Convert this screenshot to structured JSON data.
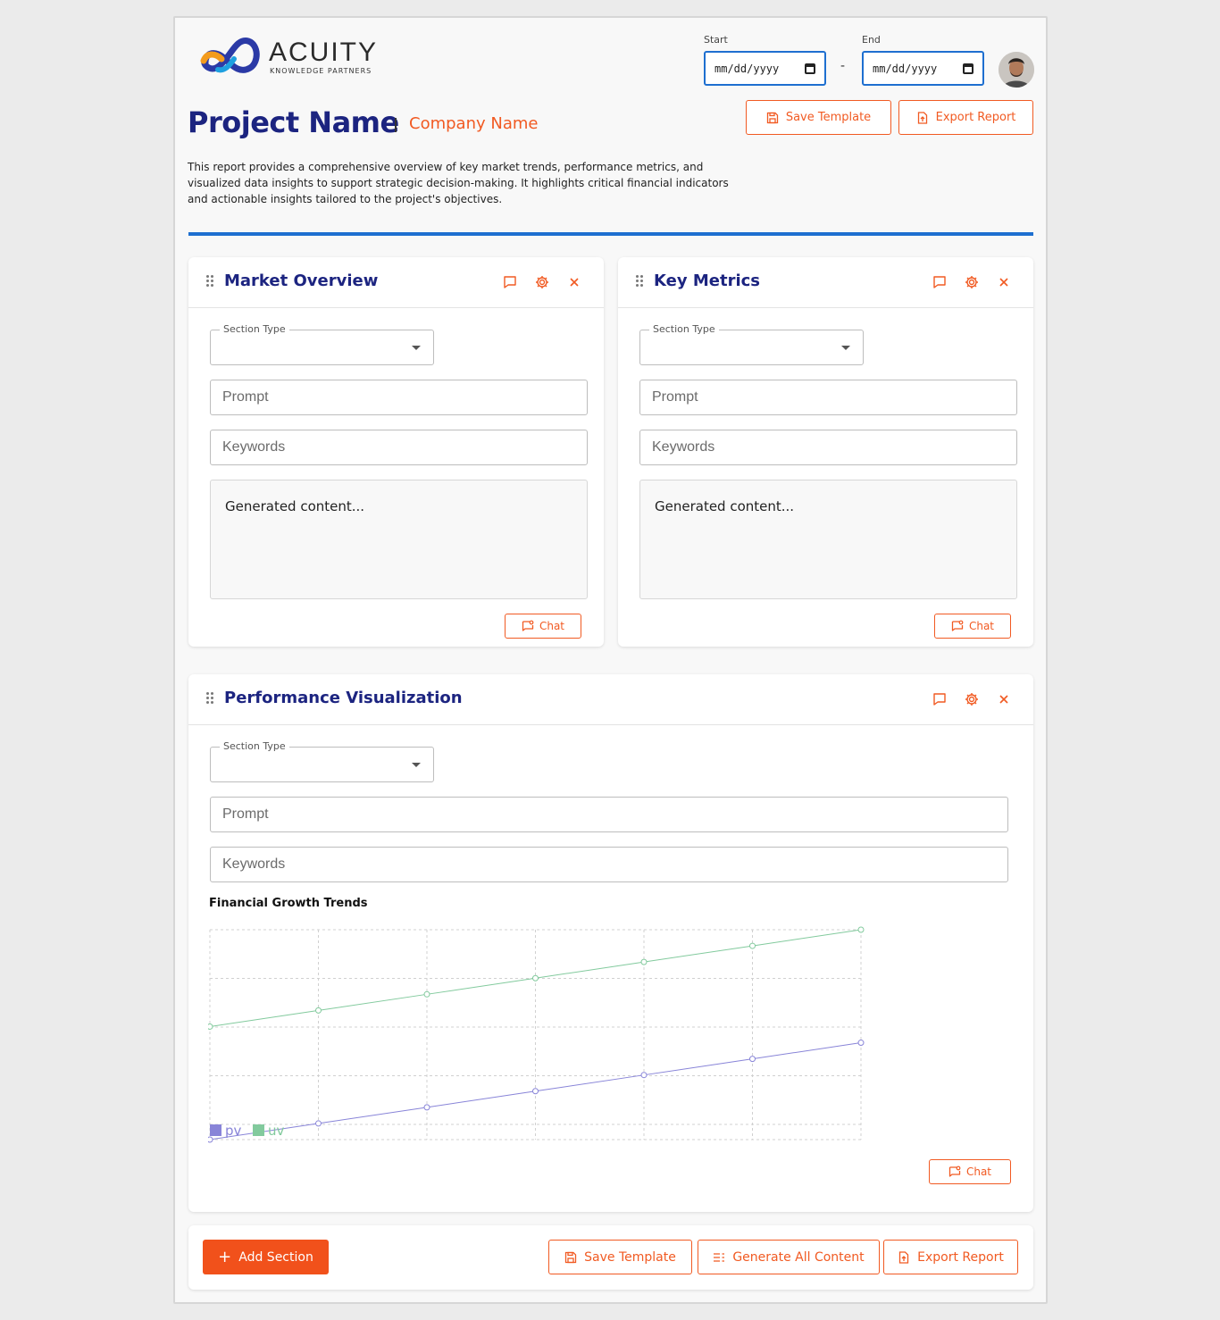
{
  "brand": {
    "name": "ACUITY",
    "tagline": "KNOWLEDGE PARTNERS"
  },
  "header": {
    "start_label": "Start",
    "end_label": "End",
    "date_placeholder": "mm/dd/yyyy",
    "separator": "-",
    "project_name": "Project Name",
    "company_name": "Company Name",
    "save_template": "Save Template",
    "export_report": "Export Report",
    "description": "This report provides a comprehensive overview of key market trends, performance metrics, and visualized data insights to support strategic decision-making. It highlights critical financial indicators and actionable insights tailored to the project's objectives."
  },
  "sections": [
    {
      "title": "Market Overview",
      "section_type_label": "Section Type",
      "prompt_placeholder": "Prompt",
      "keywords_placeholder": "Keywords",
      "generated": "Generated content...",
      "chat": "Chat"
    },
    {
      "title": "Key Metrics",
      "section_type_label": "Section Type",
      "prompt_placeholder": "Prompt",
      "keywords_placeholder": "Keywords",
      "generated": "Generated content...",
      "chat": "Chat"
    },
    {
      "title": "Performance Visualization",
      "section_type_label": "Section Type",
      "prompt_placeholder": "Prompt",
      "keywords_placeholder": "Keywords",
      "chat": "Chat"
    }
  ],
  "chart_data": {
    "type": "line",
    "title": "Financial Growth Trends",
    "xlabel": "",
    "ylabel": "",
    "x": [
      0,
      1,
      2,
      3,
      4,
      5,
      6
    ],
    "ylim": [
      0,
      13
    ],
    "grid": true,
    "legend_placement": "bottom-left",
    "series": [
      {
        "name": "pv",
        "color": "#8884d8",
        "values": [
          0,
          1,
          2,
          3,
          4,
          5,
          6
        ]
      },
      {
        "name": "uv",
        "color": "#82ca9d",
        "values": [
          7,
          8,
          9,
          10,
          11,
          12,
          13
        ]
      }
    ]
  },
  "footer": {
    "add_section": "Add Section",
    "save_template": "Save Template",
    "generate_all": "Generate All Content",
    "export_report": "Export Report"
  },
  "colors": {
    "accent": "#f15a22",
    "primary": "#1c2480",
    "rule": "#1e6fd0"
  }
}
